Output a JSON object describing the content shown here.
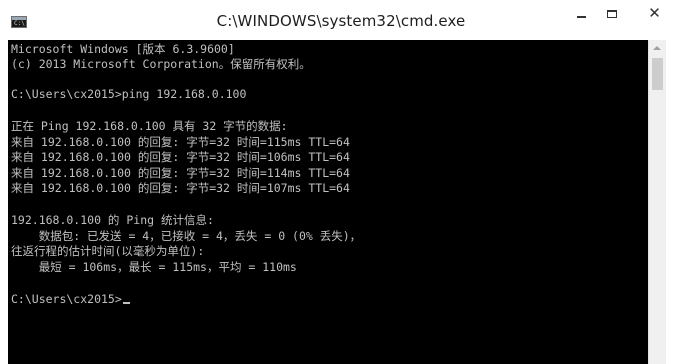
{
  "window": {
    "title": "C:\\WINDOWS\\system32\\cmd.exe",
    "icon": "cmd-icon",
    "icon_prompt": "C:\\",
    "controls": {
      "minimize_icon": "minimize-icon",
      "maximize_icon": "maximize-icon",
      "close_icon": "close-icon",
      "close_glyph": "✕"
    }
  },
  "console": {
    "background": "#000000",
    "foreground": "#c0c0c0",
    "lines": [
      "Microsoft Windows [版本 6.3.9600]",
      "(c) 2013 Microsoft Corporation。保留所有权利。",
      "",
      "C:\\Users\\cx2015>ping 192.168.0.100",
      "",
      "正在 Ping 192.168.0.100 具有 32 字节的数据:",
      "来自 192.168.0.100 的回复: 字节=32 时间=115ms TTL=64",
      "来自 192.168.0.100 的回复: 字节=32 时间=106ms TTL=64",
      "来自 192.168.0.100 的回复: 字节=32 时间=114ms TTL=64",
      "来自 192.168.0.100 的回复: 字节=32 时间=107ms TTL=64",
      "",
      "192.168.0.100 的 Ping 统计信息:",
      "    数据包: 已发送 = 4，已接收 = 4，丢失 = 0 (0% 丢失)，",
      "往返行程的估计时间(以毫秒为单位):",
      "    最短 = 106ms，最长 = 115ms，平均 = 110ms",
      "",
      "C:\\Users\\cx2015>"
    ]
  },
  "scrollbar": {
    "up_icon": "scroll-up-arrow-icon",
    "position": 0
  }
}
